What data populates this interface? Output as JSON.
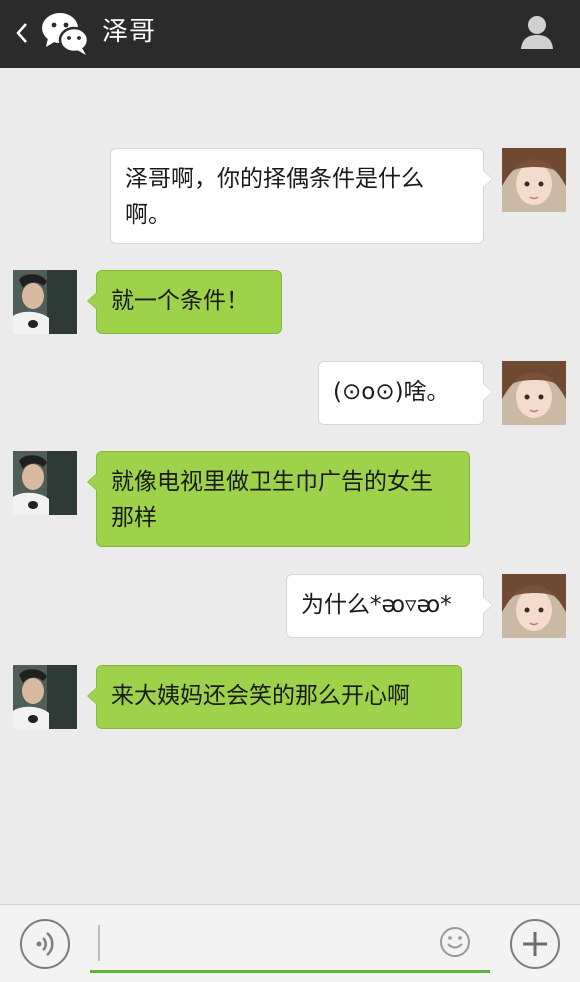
{
  "header": {
    "title": "泽哥",
    "back_icon": "chevron-left-icon",
    "app_icon": "wechat-logo-icon",
    "profile_icon": "person-icon",
    "background": "#2b2b2b"
  },
  "messages": [
    {
      "sender": "me",
      "text": "泽哥啊，你的择偶条件是什么啊。"
    },
    {
      "sender": "contact",
      "text": "就一个条件！"
    },
    {
      "sender": "me",
      "text": "(⊙o⊙)啥。"
    },
    {
      "sender": "contact",
      "text": "就像电视里做卫生巾广告的女生那样"
    },
    {
      "sender": "me",
      "text": "为什么*ᴔ▿ᴔ*"
    },
    {
      "sender": "contact",
      "text": "来大姨妈还会笑的那么开心啊"
    }
  ],
  "colors": {
    "chat_background": "#ebebeb",
    "my_bubble": "#ffffff",
    "contact_bubble": "#9ed24a",
    "input_underline": "#5fb336"
  },
  "input_bar": {
    "voice_icon": "voice-icon",
    "emoji_icon": "smiley-icon",
    "plus_icon": "plus-icon",
    "text_value": ""
  }
}
